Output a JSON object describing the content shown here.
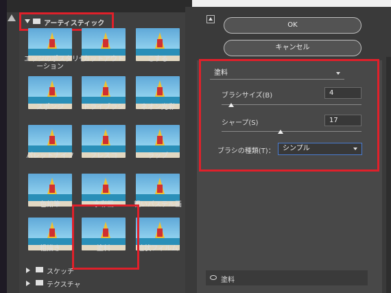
{
  "gallery": {
    "artistic_folder": "アーティスティック",
    "filters": [
      {
        "label": "エッジのポスタリゼ\nーション"
      },
      {
        "label": "カットアウト"
      },
      {
        "label": "こする"
      },
      {
        "label": "スポンジ"
      },
      {
        "label": "ドライブラシ"
      },
      {
        "label": "ネオン光彩"
      },
      {
        "label": "パレットナイフ"
      },
      {
        "label": "フレスコ"
      },
      {
        "label": "ラップ"
      },
      {
        "label": "色鉛筆"
      },
      {
        "label": "水彩画"
      },
      {
        "label": "粗いパステル画"
      },
      {
        "label": "粗描き"
      },
      {
        "label": "塗料"
      },
      {
        "label": "粒状フィルム"
      }
    ],
    "selected_filter": "塗料",
    "other_folders": [
      "スケッチ",
      "テクスチャ"
    ]
  },
  "buttons": {
    "ok": "OK",
    "cancel": "キャンセル"
  },
  "settings": {
    "filter_select": "塗料",
    "brush_size_label": "ブラシサイズ(B)",
    "brush_size_value": "4",
    "brush_size_fraction": 0.07,
    "sharpness_label": "シャープ(S)",
    "sharpness_value": "17",
    "sharpness_fraction": 0.42,
    "brush_type_label": "ブラシの種類(T)：",
    "brush_type_value": "シンプル"
  },
  "layers": {
    "effect_layer": "塗料"
  },
  "colors": {
    "highlight": "#e0202a",
    "accent_field": "#4a7cd0"
  }
}
